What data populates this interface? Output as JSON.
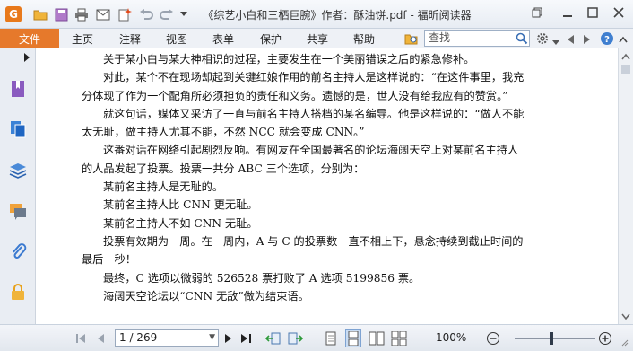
{
  "titlebar": {
    "title": "《综艺小白和三栖巨腕》作者：酥油饼.pdf - 福昕阅读器",
    "app_logo_letter": "G",
    "quick_access_icons": [
      "open-folder-icon",
      "save-icon",
      "print-icon",
      "email-icon",
      "new-icon",
      "undo-icon",
      "redo-icon",
      "customize-dropdown-icon"
    ],
    "window_buttons": [
      "restore-icon",
      "minimize-icon",
      "maximize-icon",
      "close-icon"
    ]
  },
  "menubar": {
    "file": "文件",
    "items": [
      "主页",
      "注释",
      "视图",
      "表单",
      "保护",
      "共享",
      "帮助"
    ],
    "search_placeholder": "查找"
  },
  "leftrail": {
    "icons": [
      "expand-panel-icon",
      "bookmark-icon",
      "pages-icon",
      "layers-icon",
      "comments-icon",
      "attachments-icon",
      "security-icon"
    ]
  },
  "document": {
    "lines": [
      "关于某小白与某大神相识的过程，主要发生在一个美丽错误之后的紧急修补。",
      "对此，某个不在现场却起到关键红娘作用的前名主持人是这样说的：“在这件事里，我充",
      "分体现了作为一个配角所必须担负的责任和义务。遗憾的是，世人没有给我应有的赞赏。”",
      "就这句话，媒体又采访了一直与前名主持人搭档的某名编导。他是这样说的：“做人不能",
      "太无耻，做主持人尤其不能，不然 NCC 就会变成 CNN。”",
      "这番对话在网络引起剧烈反响。有网友在全国最著名的论坛海阔天空上对某前名主持人",
      "的人品发起了投票。投票一共分 ABC 三个选项，分别为：",
      "某前名主持人是无耻的。",
      "某前名主持人比 CNN 更无耻。",
      "某前名主持人不如 CNN 无耻。",
      "投票有效期为一周。在一周内，A 与 C 的投票数一直不相上下，悬念持续到截止时间的",
      "最后一秒！",
      "最终，C 选项以微弱的 526528 票打败了 A 选项 5199856 票。",
      "海阔天空论坛以“CNN 无敌”做为结束语。"
    ]
  },
  "statusbar": {
    "page_display": "1 / 269",
    "zoom": "100%"
  }
}
